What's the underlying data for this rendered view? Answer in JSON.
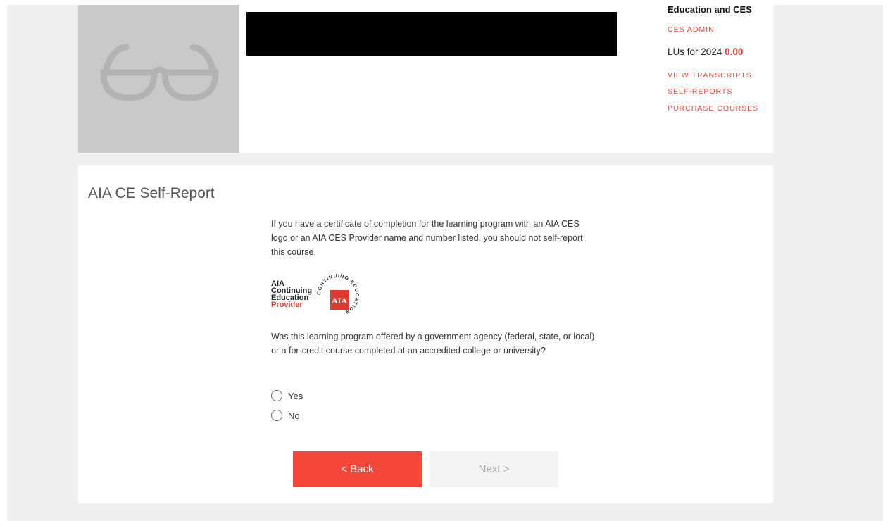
{
  "ces_panel": {
    "title": "Education and CES",
    "admin_link": "CES ADMIN",
    "lu_label": "LUs for 2024",
    "lu_value": "0.00",
    "links": [
      "VIEW TRANSCRIPTS",
      "SELF-REPORTS",
      "PURCHASE COURSES"
    ]
  },
  "avatar": {
    "icon": "glasses-icon"
  },
  "report": {
    "title": "AIA CE Self-Report",
    "intro": "If you have a certificate of completion for the learning program with an AIA CES logo or an AIA CES Provider name and number listed, you should not self-report this course.",
    "logo": {
      "line1": "AIA",
      "line2": "Continuing",
      "line3": "Education",
      "line4": "Provider",
      "ring_text": "CONTINUING EDUCATION"
    },
    "question": "Was this learning program offered by a government agency (federal, state, or local) or a for-credit course completed at an accredited college or university?",
    "options": [
      "Yes",
      "No"
    ],
    "back_label": "< Back",
    "next_label": "Next >"
  },
  "colors": {
    "accent": "#f4473a",
    "link": "#e8463a",
    "page_bg": "#efefef",
    "avatar_bg": "#c9c9c9"
  }
}
